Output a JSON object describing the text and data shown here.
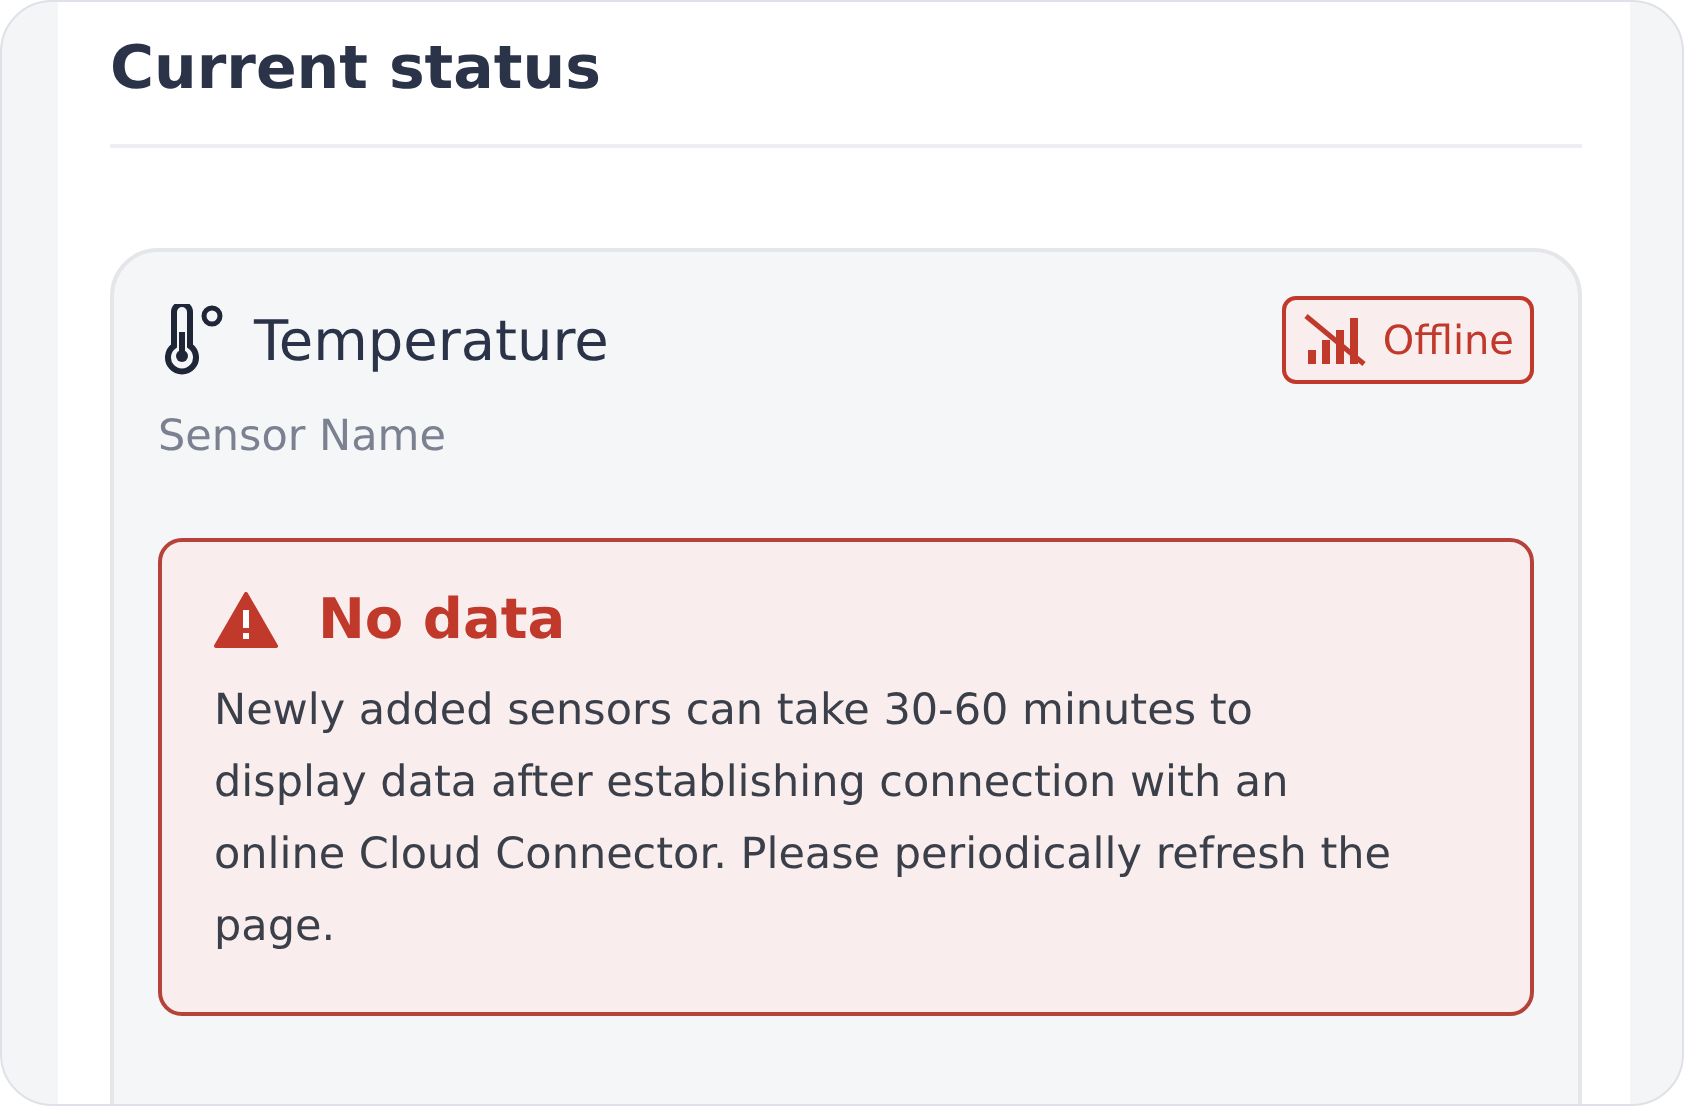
{
  "section": {
    "title": "Current status"
  },
  "sensor": {
    "type_label": "Temperature",
    "name": "Sensor Name",
    "status": {
      "kind": "offline",
      "label": "Offline"
    },
    "alert": {
      "kind": "error",
      "title": "No data",
      "message": "Newly added sensors can take 30-60 minutes to display data after establishing connection with an online Cloud Connector. Please periodically refresh the page."
    }
  }
}
